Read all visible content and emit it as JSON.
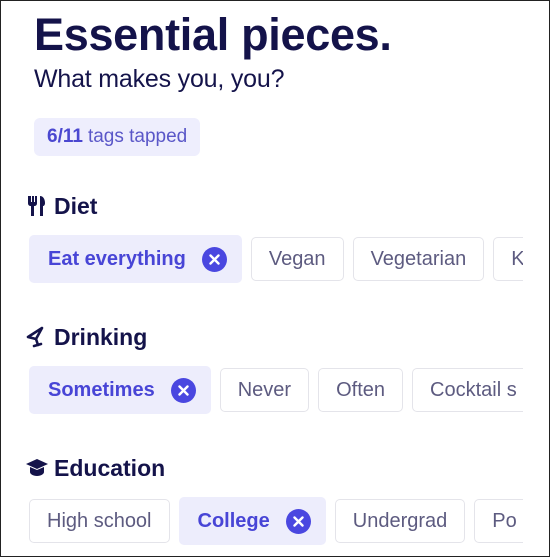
{
  "header": {
    "title": "Essential pieces.",
    "subtitle": "What makes you, you?"
  },
  "counter": {
    "value": "6/11",
    "label": "tags tapped"
  },
  "colors": {
    "primary": "#4a47e0",
    "selected_bg": "#ededfc",
    "heading": "#14134a",
    "tag_text": "#5d5b80"
  },
  "sections": [
    {
      "label": "Diet",
      "icon": "utensils-icon",
      "tags": [
        {
          "label": "Eat everything",
          "selected": true
        },
        {
          "label": "Vegan",
          "selected": false
        },
        {
          "label": "Vegetarian",
          "selected": false
        },
        {
          "label": "K",
          "selected": false
        }
      ]
    },
    {
      "label": "Drinking",
      "icon": "cocktail-glass-icon",
      "tags": [
        {
          "label": "Sometimes",
          "selected": true
        },
        {
          "label": "Never",
          "selected": false
        },
        {
          "label": "Often",
          "selected": false
        },
        {
          "label": "Cocktail s",
          "selected": false
        }
      ]
    },
    {
      "label": "Education",
      "icon": "graduation-cap-icon",
      "tags": [
        {
          "label": "High school",
          "selected": false
        },
        {
          "label": "College",
          "selected": true
        },
        {
          "label": "Undergrad",
          "selected": false
        },
        {
          "label": "Po",
          "selected": false
        }
      ]
    }
  ]
}
